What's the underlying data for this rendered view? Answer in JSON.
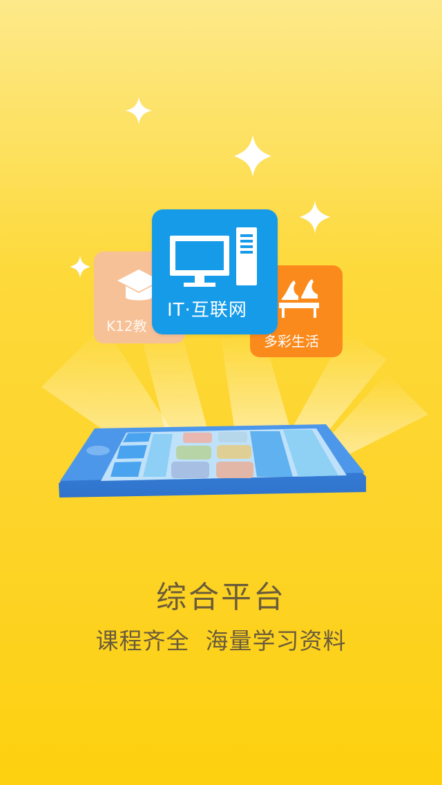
{
  "screen": {
    "cards": {
      "k12": {
        "label": "K12教",
        "icon": "graduation-cap-icon",
        "color": "#f7c198"
      },
      "it": {
        "label": "IT·互联网",
        "icon": "computer-icon",
        "color": "#169be9"
      },
      "life": {
        "label": "多彩生活",
        "icon": "high-heels-icon",
        "color": "#fb8a1c"
      }
    },
    "headline": "综合平台",
    "subline": "课程齐全  海量学习资料"
  },
  "colors": {
    "background_top": "#fde98a",
    "background_bottom": "#fdd10f",
    "tablet_blue": "#4a90e2",
    "text": "#6a5b3a"
  }
}
